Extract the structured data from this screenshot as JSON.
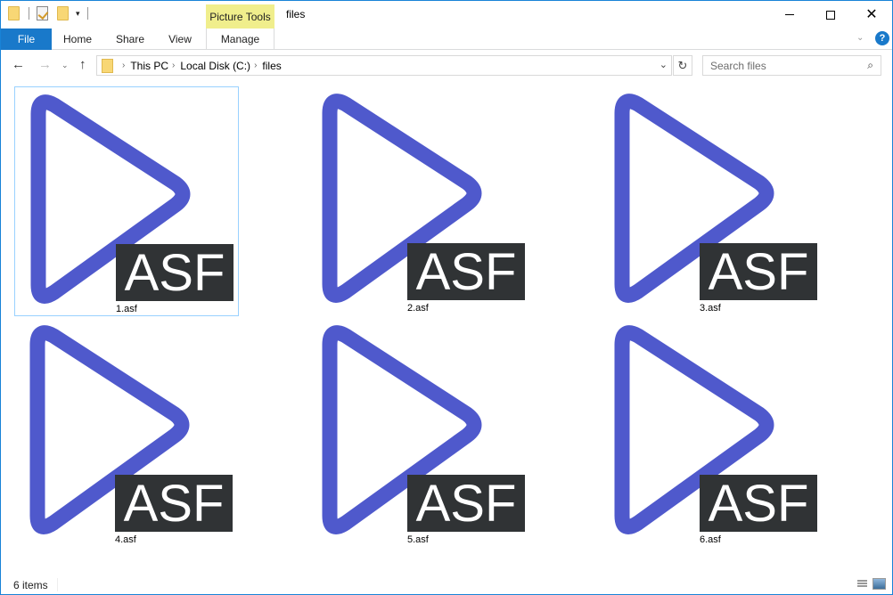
{
  "window": {
    "title": "files",
    "context_tab_group": "Picture Tools",
    "controls": {
      "minimize": "minimize",
      "maximize": "maximize",
      "close": "✕"
    }
  },
  "quick_access": {
    "icons": [
      "folder-icon",
      "properties-icon",
      "new-folder-icon",
      "customize-dropdown-icon"
    ],
    "dropdown_glyph": "▾"
  },
  "ribbon": {
    "tabs": [
      {
        "label": "File",
        "active": true
      },
      {
        "label": "Home"
      },
      {
        "label": "Share"
      },
      {
        "label": "View"
      },
      {
        "label": "Manage"
      }
    ],
    "expand_glyph": "⌄",
    "help_glyph": "?"
  },
  "nav": {
    "back_glyph": "←",
    "forward_glyph": "→",
    "recent_glyph": "⌄",
    "up_glyph": "↑",
    "breadcrumb": [
      "This PC",
      "Local Disk (C:)",
      "files"
    ],
    "crumb_sep": "›",
    "address_dropdown_glyph": "⌄",
    "refresh_glyph": "↻",
    "search_placeholder": "Search files",
    "search_value": "",
    "search_glyph": "⌕"
  },
  "files": [
    {
      "name": "1.asf",
      "badge": "ASF",
      "selected": true
    },
    {
      "name": "2.asf",
      "badge": "ASF"
    },
    {
      "name": "3.asf",
      "badge": "ASF"
    },
    {
      "name": "4.asf",
      "badge": "ASF"
    },
    {
      "name": "5.asf",
      "badge": "ASF"
    },
    {
      "name": "6.asf",
      "badge": "ASF"
    }
  ],
  "colors": {
    "play_icon": "#4f59cc",
    "badge_bg": "#303335",
    "accent": "#1979ca",
    "selection": "#99d1ff",
    "context_tab": "#f0ee8c"
  },
  "status": {
    "item_count": "6 items"
  }
}
